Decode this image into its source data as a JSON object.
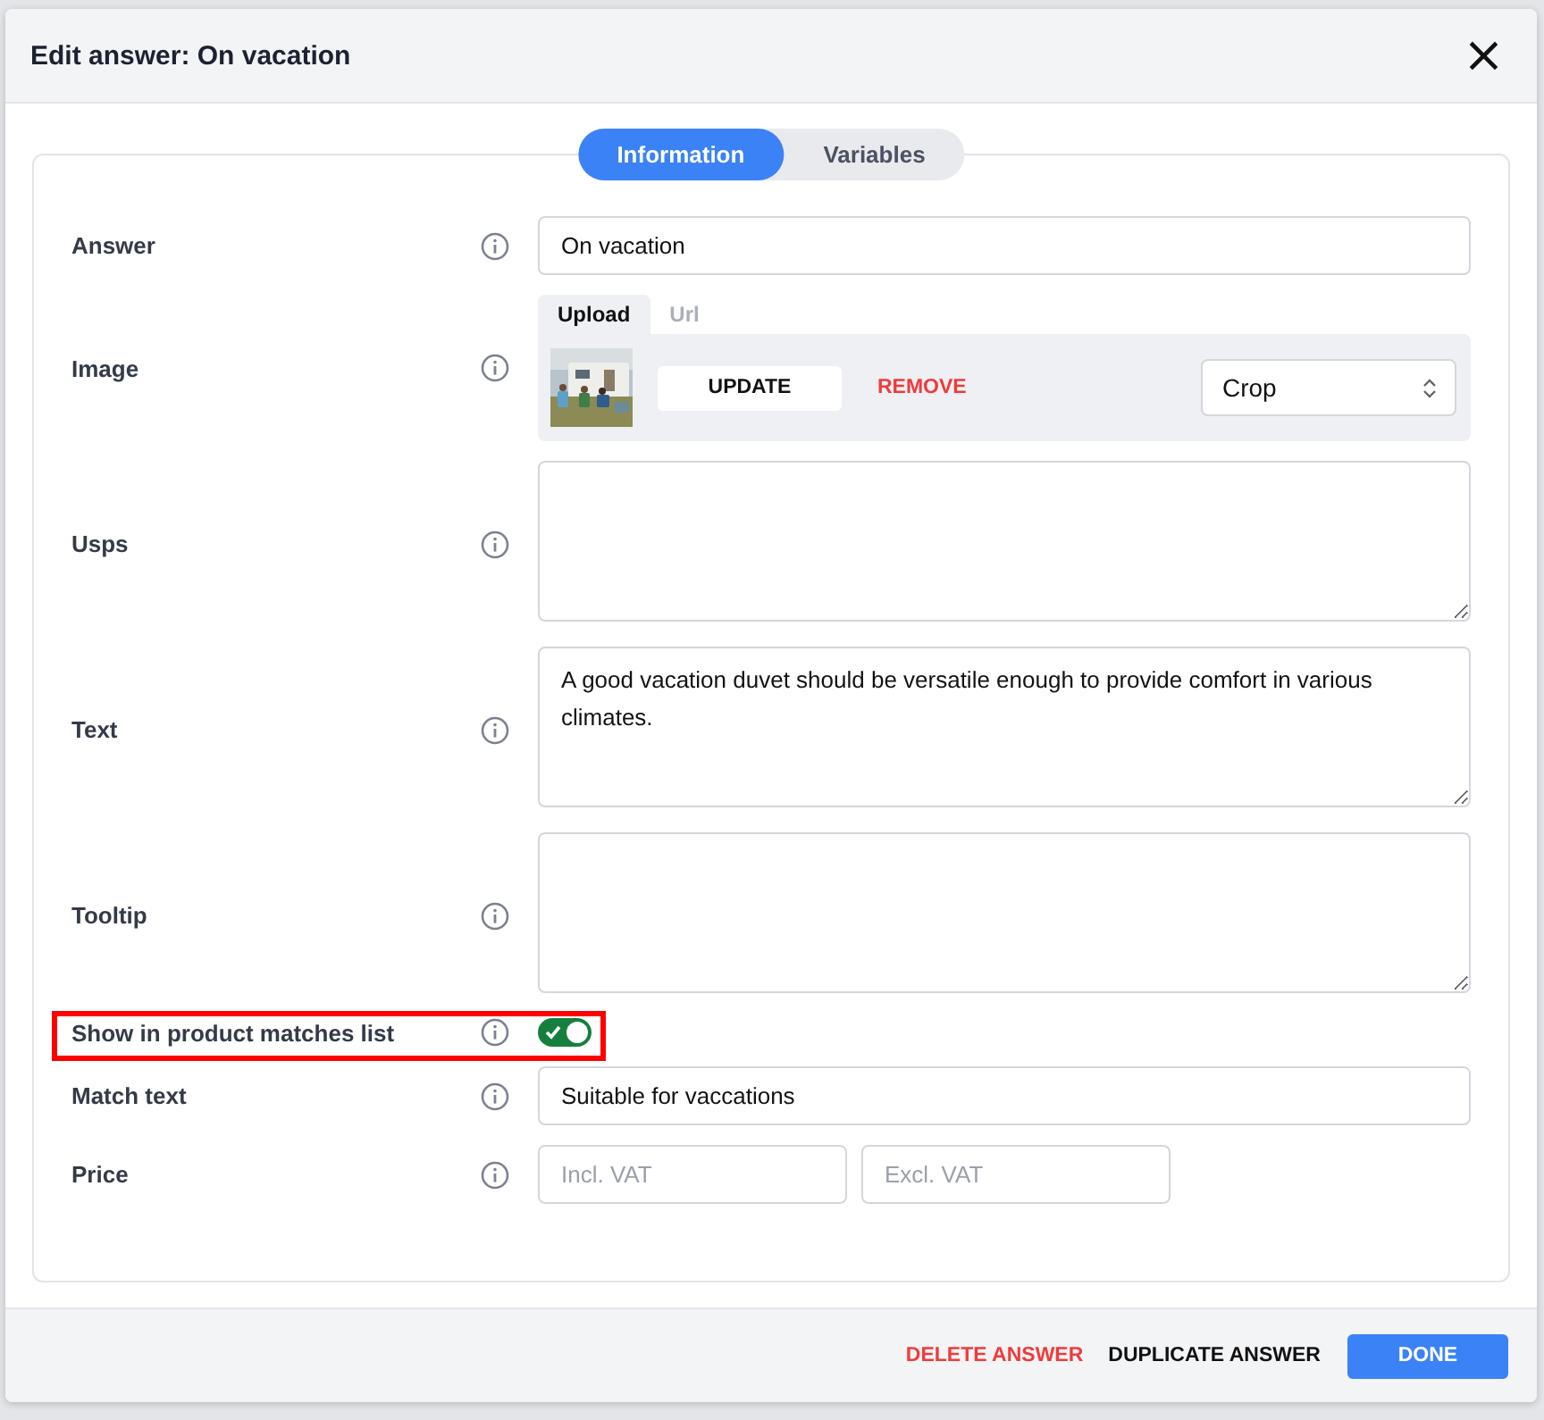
{
  "dialog": {
    "title": "Edit answer: On vacation",
    "close": "×"
  },
  "tabs": [
    {
      "label": "Information",
      "selected": true
    },
    {
      "label": "Variables",
      "selected": false
    }
  ],
  "rows": [
    {
      "kind": "text",
      "label": "Answer",
      "value": "On vacation"
    },
    {
      "label": "Image",
      "source_tabs": [
        {
          "label": "Upload",
          "selected": true
        },
        {
          "label": "Url",
          "selected": false
        }
      ],
      "update": "UPDATE",
      "remove": "REMOVE",
      "fit": "Crop"
    },
    {
      "kind": "textarea",
      "label": "Usps",
      "value": ""
    },
    {
      "kind": "textarea",
      "label": "Text",
      "value": "A good vacation duvet should be versatile enough to provide comfort in various climates."
    },
    {
      "kind": "textarea",
      "label": "Tooltip",
      "value": ""
    },
    {
      "kind": "toggle",
      "label": "Show in product matches list",
      "on": true,
      "highlighted": true
    },
    {
      "kind": "text",
      "label": "Match text",
      "value": "Suitable for vaccations"
    },
    {
      "kind": "price",
      "label": "Price",
      "fields": [
        {
          "placeholder": "Incl. VAT"
        },
        {
          "placeholder": "Excl. VAT"
        }
      ]
    }
  ],
  "footer": {
    "delete": "DELETE ANSWER",
    "duplicate": "DUPLICATE ANSWER",
    "done": "DONE"
  }
}
